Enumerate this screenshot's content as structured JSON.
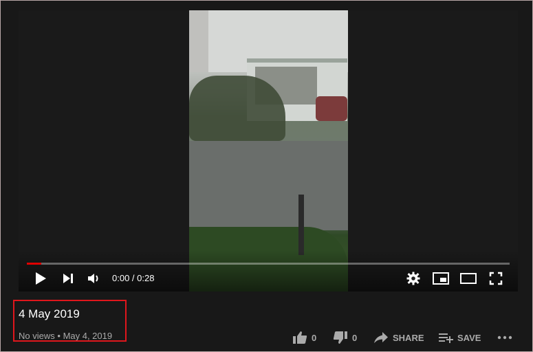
{
  "player": {
    "time_current": "0:00",
    "time_separator": " / ",
    "time_total": "0:28",
    "progress_fraction": 0.03,
    "progress_color": "#e00000"
  },
  "video": {
    "title": "4 May 2019",
    "views": "No views",
    "dot": "•",
    "date": "May 4, 2019"
  },
  "actions": {
    "like_count": "0",
    "dislike_count": "0",
    "share_label": "SHARE",
    "save_label": "SAVE"
  },
  "icons": [
    "play-icon",
    "next-icon",
    "volume-icon",
    "settings-icon",
    "miniplayer-icon",
    "theater-icon",
    "fullscreen-icon",
    "thumbs-up-icon",
    "thumbs-down-icon",
    "share-icon",
    "save-icon",
    "more-icon"
  ],
  "colors": {
    "highlight": "#e0161c",
    "background": "#181818"
  }
}
